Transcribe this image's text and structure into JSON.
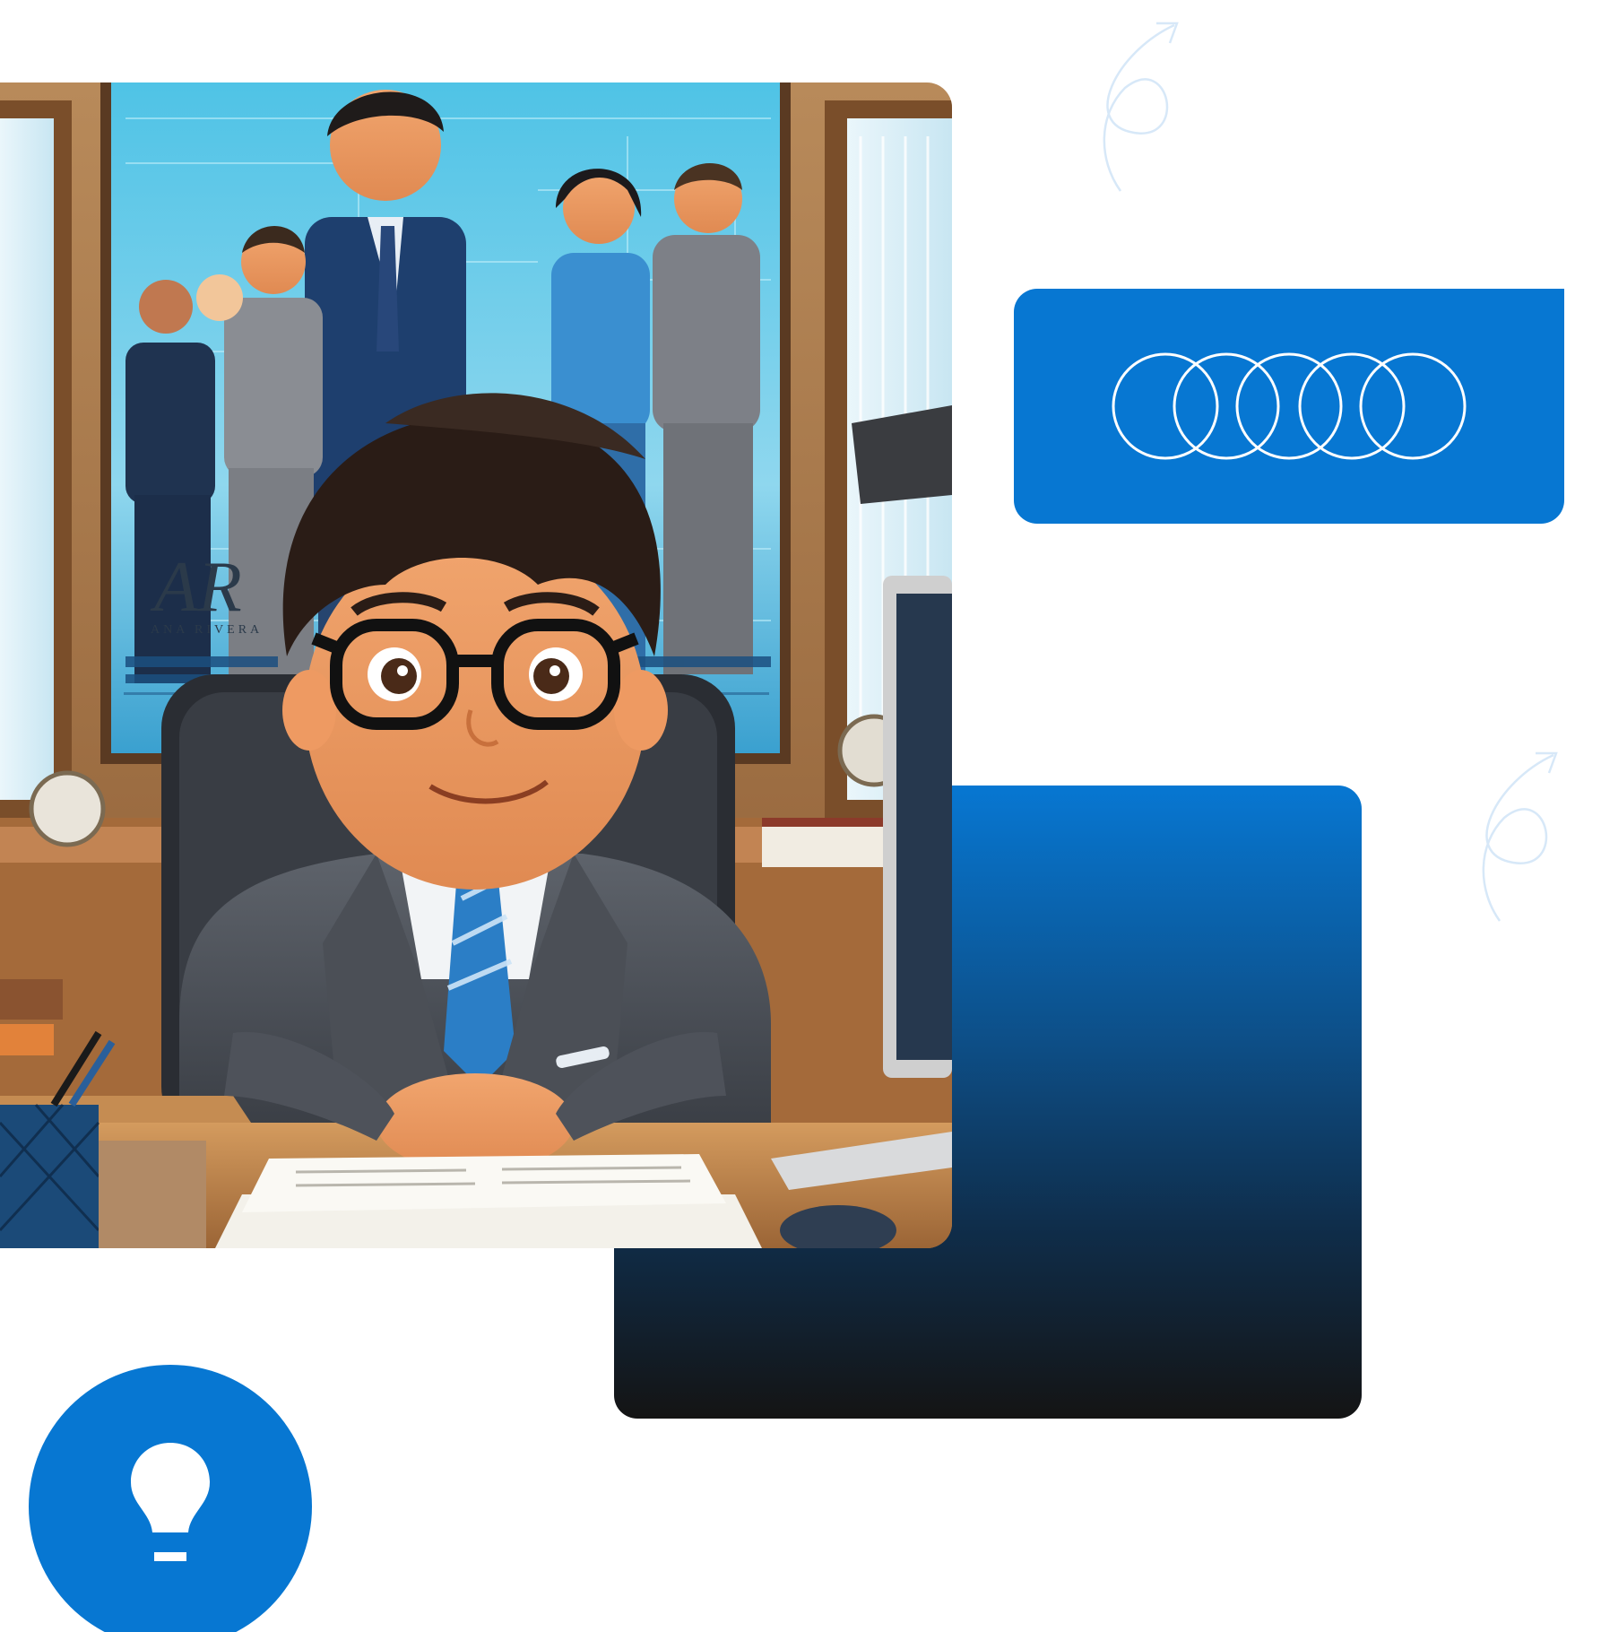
{
  "illustration": {
    "monogram": "AR",
    "signature": "ANA RIVERA",
    "icon": "businessman-portrait-illustration"
  },
  "circles_card": {
    "icon": "overlapping-rings-icon",
    "ring_count": 5
  },
  "bulb_badge": {
    "icon": "lightbulb-icon"
  },
  "colors": {
    "brand_blue": "#0777d2",
    "gradient_dark": "#141414",
    "deco_stroke": "#cfe3f6"
  }
}
